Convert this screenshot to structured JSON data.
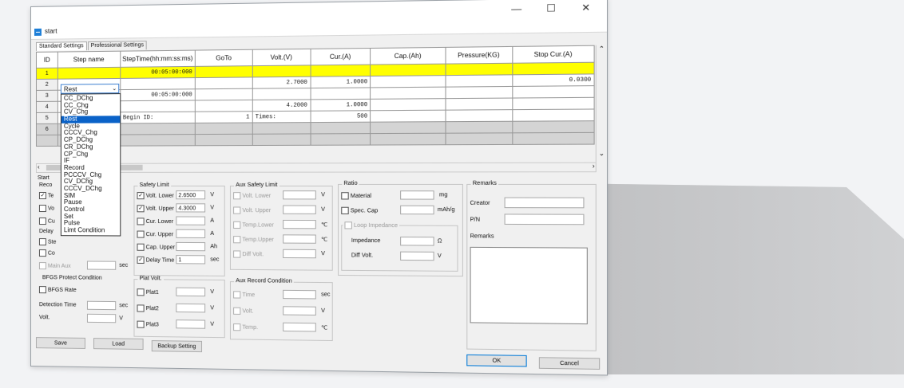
{
  "window": {
    "title": "start",
    "minimize": "—",
    "maximize": "☐",
    "close": "✕"
  },
  "tabs": [
    "Standard Settings",
    "Professional Settings"
  ],
  "grid": {
    "headers": [
      "ID",
      "Step name",
      "StepTime(hh:mm:ss:ms)",
      "GoTo",
      "Volt.(V)",
      "Cur.(A)",
      "Cap.(Ah)",
      "Pressure(KG)",
      "Stop Cur.(A)"
    ],
    "rows": [
      [
        "1",
        "Rest",
        "00:05:00:000",
        "",
        "",
        "",
        "",
        "",
        ""
      ],
      [
        "2",
        "",
        "",
        "",
        "2.7000",
        "1.0000",
        "",
        "",
        "0.0300"
      ],
      [
        "3",
        "",
        "00:05:00:000",
        "",
        "",
        "",
        "",
        "",
        ""
      ],
      [
        "4",
        "",
        "",
        "",
        "4.2000",
        "1.0000",
        "",
        "",
        ""
      ],
      [
        "5",
        "",
        "Begin ID:",
        "1",
        "Times:",
        "500",
        "",
        "",
        ""
      ],
      [
        "6",
        "",
        "",
        "",
        "",
        "",
        "",
        "",
        ""
      ]
    ]
  },
  "combo": {
    "value": "Rest",
    "arrow": "⌄"
  },
  "dropdown": [
    "CC_DChg",
    "CC_Chg",
    "CV_Chg",
    "Rest",
    "Cycle",
    "CCCV_Chg",
    "CP_DChg",
    "CR_DChg",
    "CP_Chg",
    "IF",
    "Record",
    "PCCCV_Chg",
    "CV_DChg",
    "CCCV_DChg",
    "SIM",
    "Pause",
    "Control",
    "Set",
    "Pulse",
    "Limt Condition"
  ],
  "dropdown_selected": "Rest",
  "left_panel": {
    "start": "Start",
    "rec": "Reco",
    "items": [
      "Te",
      "Vo",
      "Cu",
      "Delay",
      "Ste",
      "Co"
    ],
    "main_aux": "Main Aux",
    "sec": "sec",
    "bfgs_title": "BFGS Protect Condition",
    "bfgs_rate": "BFGS Rate",
    "detection_time": "Detection Time",
    "volt": "Volt.",
    "v": "V"
  },
  "safety_limit": {
    "title": "Safety Limit",
    "rows": [
      {
        "label": "Volt. Lower",
        "value": "2.6500",
        "unit": "V",
        "checked": true
      },
      {
        "label": "Volt. Upper",
        "value": "4.3000",
        "unit": "V",
        "checked": true
      },
      {
        "label": "Cur. Lower",
        "value": "",
        "unit": "A",
        "checked": false
      },
      {
        "label": "Cur. Upper",
        "value": "",
        "unit": "A",
        "checked": false
      },
      {
        "label": "Cap. Upper",
        "value": "",
        "unit": "Ah",
        "checked": false
      },
      {
        "label": "Delay Time",
        "value": "1",
        "unit": "sec",
        "checked": true
      }
    ]
  },
  "plat_volt": {
    "title": "Plat Volt.",
    "rows": [
      {
        "label": "Plat1",
        "unit": "V"
      },
      {
        "label": "Plat2",
        "unit": "V"
      },
      {
        "label": "Plat3",
        "unit": "V"
      }
    ]
  },
  "aux_safety": {
    "title": "Aux Safety Limit",
    "rows": [
      {
        "label": "Volt. Lower",
        "unit": "V"
      },
      {
        "label": "Volt. Upper",
        "unit": "V"
      },
      {
        "label": "Temp.Lower",
        "unit": "℃"
      },
      {
        "label": "Temp.Upper",
        "unit": "℃"
      },
      {
        "label": "Diff Volt.",
        "unit": "V"
      }
    ]
  },
  "aux_record": {
    "title": "Aux Record Condition",
    "rows": [
      {
        "label": "Time",
        "unit": "sec"
      },
      {
        "label": "Volt.",
        "unit": "V"
      },
      {
        "label": "Temp.",
        "unit": "℃"
      }
    ]
  },
  "ratio": {
    "title": "Ratio",
    "material": "Material",
    "material_unit": "mg",
    "spec_cap": "Spec. Cap",
    "spec_unit": "mAh/g",
    "loop": "Loop Impedance",
    "impedance": "Impedance",
    "impedance_unit": "Ω",
    "diff_volt": "Diff Volt.",
    "diff_unit": "V"
  },
  "remarks": {
    "title": "Remarks",
    "creator": "Creator",
    "pn": "P/N",
    "remarks": "Remarks"
  },
  "buttons": {
    "save": "Save",
    "load": "Load",
    "backup": "Backup Setting",
    "ok": "OK",
    "cancel": "Cancel"
  }
}
